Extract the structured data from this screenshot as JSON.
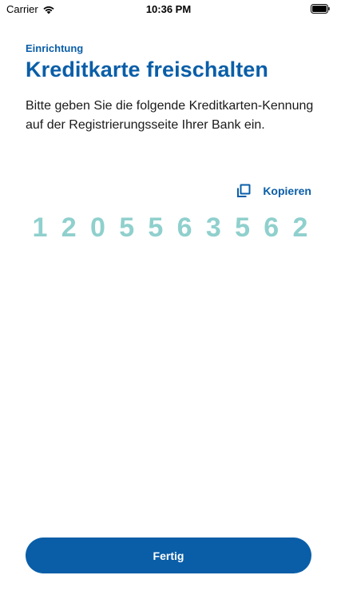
{
  "status_bar": {
    "carrier": "Carrier",
    "time": "10:36 PM"
  },
  "header": {
    "overline": "Einrichtung",
    "title": "Kreditkarte freischalten"
  },
  "instructions": "Bitte geben Sie die folgende Kreditkarten-Kennung auf der Registrierungsseite Ihrer Bank ein.",
  "copy": {
    "label": "Kopieren",
    "icon": "copy-icon"
  },
  "card_id": {
    "digits": [
      "1",
      "2",
      "0",
      "5",
      "5",
      "6",
      "3",
      "5",
      "6",
      "2"
    ]
  },
  "footer": {
    "done_label": "Fertig"
  },
  "colors": {
    "brand": "#0a5ea8",
    "digits": "#8fd0cd"
  }
}
